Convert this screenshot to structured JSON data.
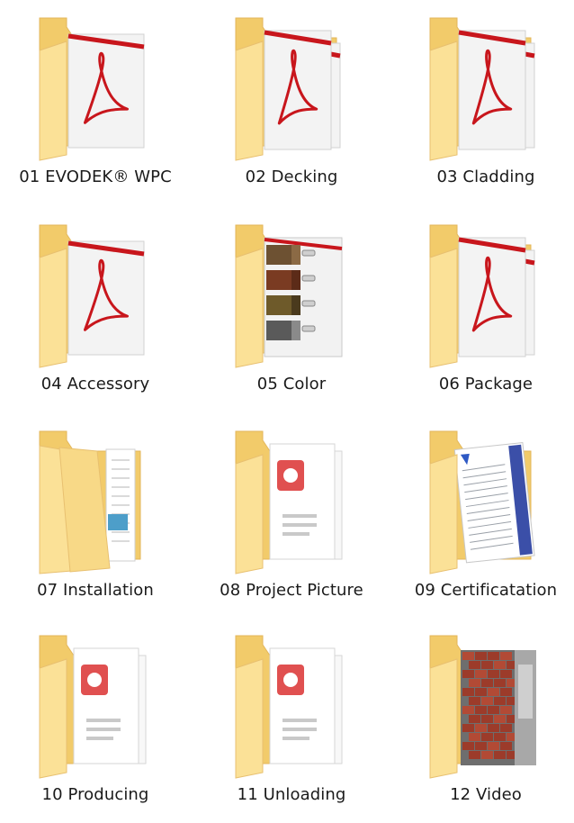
{
  "folders": [
    {
      "label": "01 EVODEK® WPC",
      "icon": "pdf-folder-icon",
      "variant": "pdf-single"
    },
    {
      "label": "02 Decking",
      "icon": "pdf-folder-icon",
      "variant": "pdf-double"
    },
    {
      "label": "03 Cladding",
      "icon": "pdf-folder-icon",
      "variant": "pdf-double"
    },
    {
      "label": "04 Accessory",
      "icon": "pdf-folder-icon",
      "variant": "pdf-single"
    },
    {
      "label": "05 Color",
      "icon": "color-swatch-folder-icon",
      "variant": "swatch"
    },
    {
      "label": "06 Package",
      "icon": "pdf-folder-icon",
      "variant": "pdf-double"
    },
    {
      "label": "07 Installation",
      "icon": "document-folder-icon",
      "variant": "doc"
    },
    {
      "label": "08 Project Picture",
      "icon": "picture-folder-icon",
      "variant": "picture"
    },
    {
      "label": "09 Certificatation",
      "icon": "certificate-folder-icon",
      "variant": "cert"
    },
    {
      "label": "10 Producing",
      "icon": "picture-folder-icon",
      "variant": "picture"
    },
    {
      "label": "11 Unloading",
      "icon": "picture-folder-icon",
      "variant": "picture"
    },
    {
      "label": "12 Video",
      "icon": "video-folder-icon",
      "variant": "video"
    }
  ],
  "colors": {
    "folder_back": "#f2cb6a",
    "folder_front": "#fbe197",
    "pdf_red": "#c8161c",
    "label_text": "#1a1a1a"
  }
}
